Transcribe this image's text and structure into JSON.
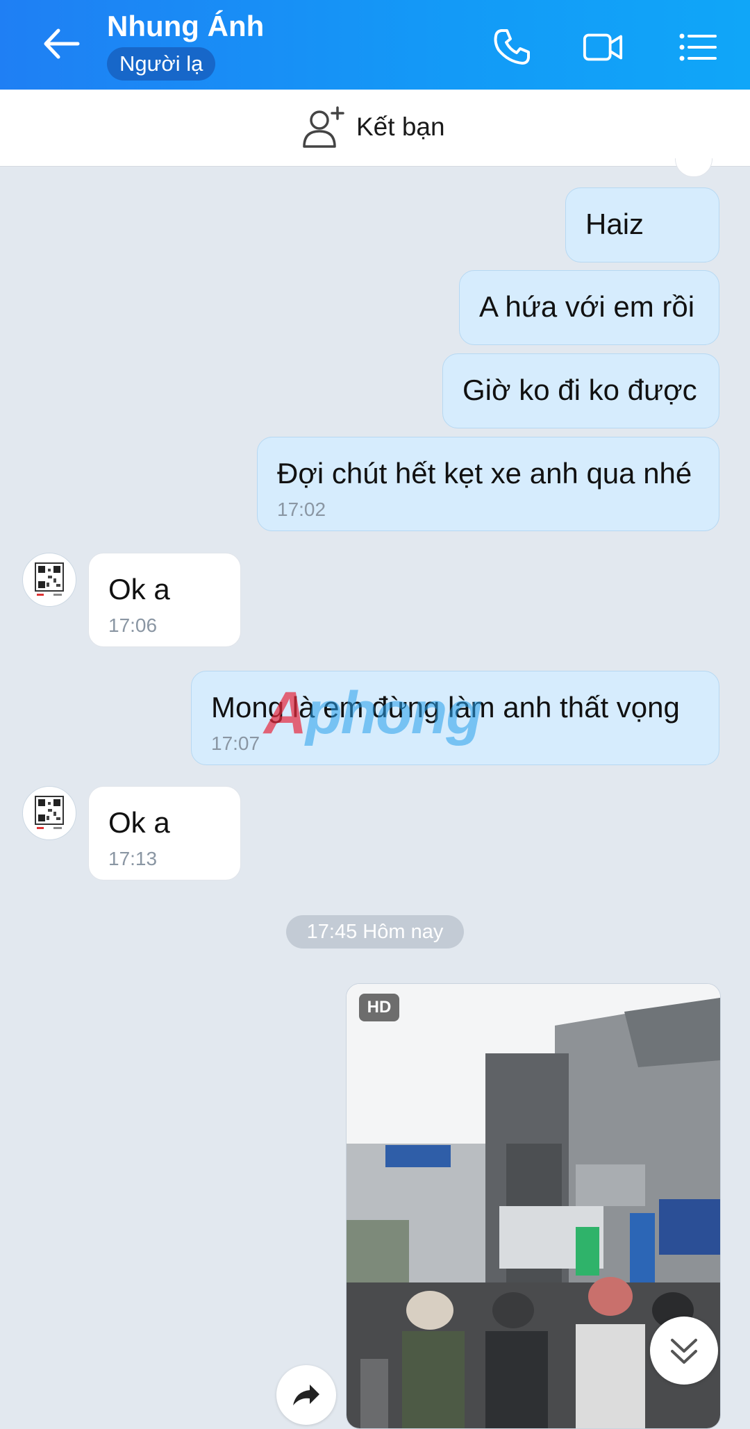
{
  "header": {
    "contact_name": "Nhung Ánh",
    "status_badge": "Người lạ",
    "icons": [
      "back-arrow-icon",
      "phone-icon",
      "video-call-icon",
      "menu-list-icon"
    ]
  },
  "friend_bar": {
    "label": "Kết bạn",
    "icon": "add-friend-icon"
  },
  "messages": [
    {
      "side": "out",
      "text": "Haiz"
    },
    {
      "side": "out",
      "text": "A hứa với em rồi"
    },
    {
      "side": "out",
      "text": "Giờ ko đi ko được"
    },
    {
      "side": "out",
      "text": "Đợi chút hết kẹt xe anh qua nhé",
      "time": "17:02"
    },
    {
      "side": "in",
      "text": "Ok a",
      "time": "17:06"
    },
    {
      "side": "out",
      "text": "Mong là em đừng làm anh thất vọng",
      "time": "17:07"
    },
    {
      "side": "in",
      "text": "Ok a",
      "time": "17:13"
    }
  ],
  "date_separator": "17:45 Hôm nay",
  "photo": {
    "badge": "HD"
  },
  "watermark": {
    "part1": "A",
    "part2": "phong"
  },
  "colors": {
    "header": "#1f7ff4",
    "outgoing_bubble": "#d6ecfd",
    "incoming_bubble": "#ffffff",
    "background": "#e2e8ef"
  }
}
